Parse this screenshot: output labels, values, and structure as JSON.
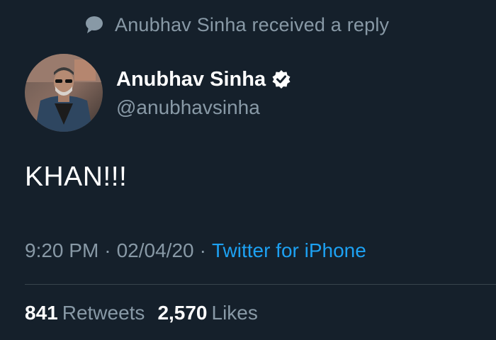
{
  "context": {
    "icon": "speech-bubble-icon",
    "text": "Anubhav Sinha received a reply"
  },
  "author": {
    "name": "Anubhav Sinha",
    "handle": "@anubhavsinha",
    "verified": true,
    "verified_icon": "verified-badge-icon"
  },
  "tweet": {
    "text": "KHAN!!!",
    "time": "9:20 PM",
    "date": "02/04/20",
    "separator": "·",
    "source": "Twitter for iPhone"
  },
  "stats": {
    "retweets_count": "841",
    "retweets_label": "Retweets",
    "likes_count": "2,570",
    "likes_label": "Likes"
  },
  "colors": {
    "background": "#15202b",
    "text_primary": "#ffffff",
    "text_secondary": "#8899a6",
    "link": "#1da1f2",
    "divider": "#38444d"
  }
}
